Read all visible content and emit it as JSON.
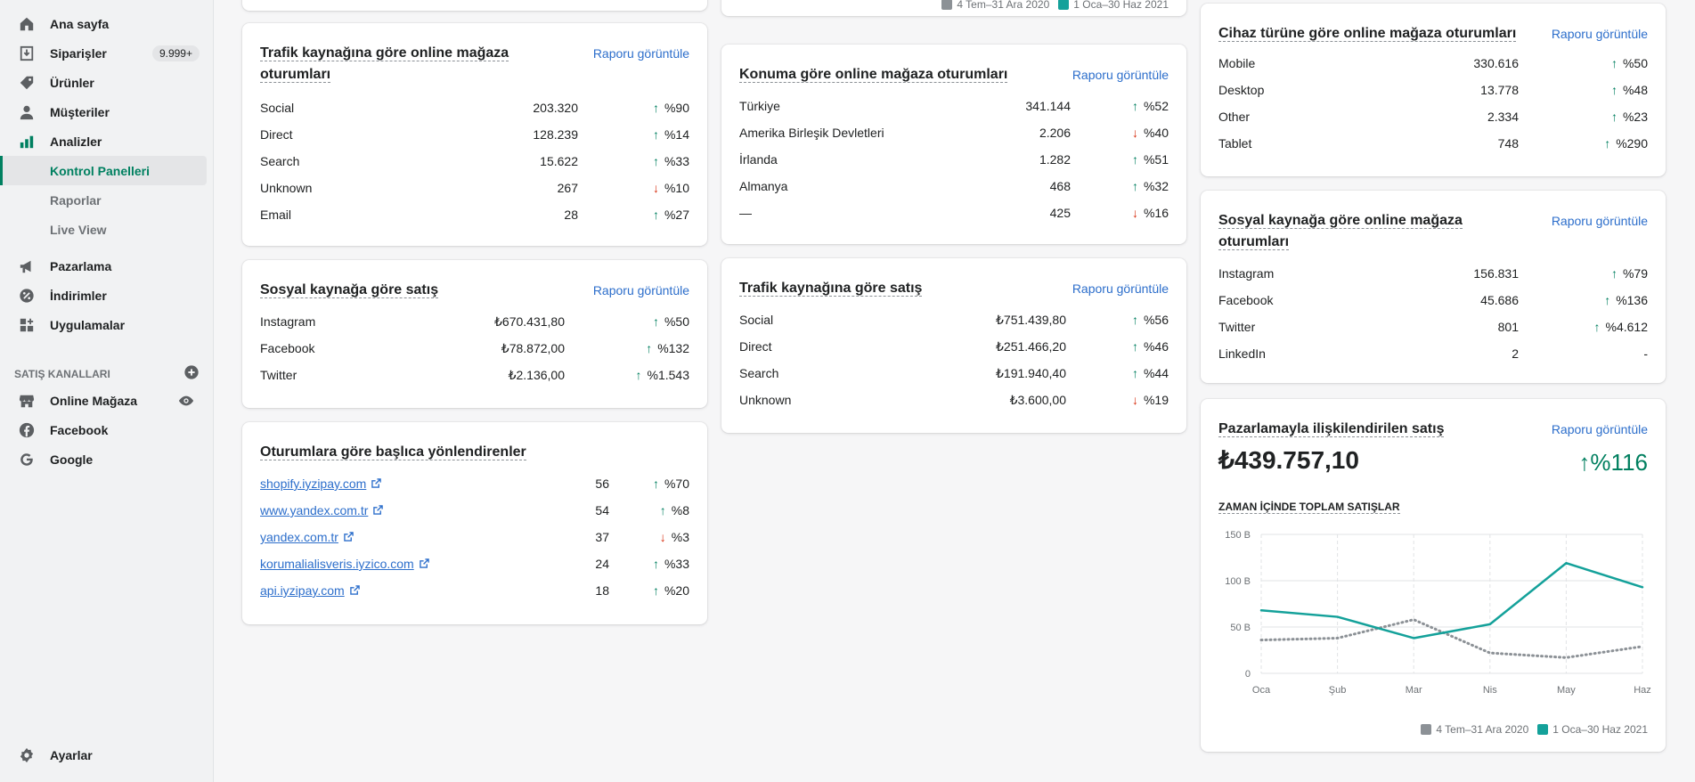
{
  "sidebar": {
    "items": [
      {
        "label": "Ana sayfa",
        "icon": "home-icon"
      },
      {
        "label": "Siparişler",
        "icon": "orders-icon",
        "badge": "9.999+"
      },
      {
        "label": "Ürünler",
        "icon": "tag-icon"
      },
      {
        "label": "Müşteriler",
        "icon": "person-icon"
      },
      {
        "label": "Analizler",
        "icon": "bar-chart-icon"
      }
    ],
    "sub_items": [
      {
        "label": "Kontrol Panelleri",
        "active": true
      },
      {
        "label": "Raporlar"
      },
      {
        "label": "Live View"
      }
    ],
    "items2": [
      {
        "label": "Pazarlama",
        "icon": "megaphone-icon"
      },
      {
        "label": "İndirimler",
        "icon": "discount-icon"
      },
      {
        "label": "Uygulamalar",
        "icon": "apps-icon"
      }
    ],
    "channels_heading": "SATIŞ KANALLARI",
    "channels": [
      {
        "label": "Online Mağaza",
        "icon": "store-icon"
      },
      {
        "label": "Facebook",
        "icon": "facebook-icon"
      },
      {
        "label": "Google",
        "icon": "google-icon"
      }
    ],
    "settings": "Ayarlar"
  },
  "report_link": "Raporu görüntüle",
  "top_legend": {
    "a": "4 Tem–31 Ara 2020",
    "b": "1 Oca–30 Haz 2021"
  },
  "cards": {
    "traffic_sessions": {
      "title": "Trafik kaynağına göre online mağaza oturumları",
      "rows": [
        {
          "name": "Social",
          "value": "203.320",
          "dir": "up",
          "change": "%90"
        },
        {
          "name": "Direct",
          "value": "128.239",
          "dir": "up",
          "change": "%14"
        },
        {
          "name": "Search",
          "value": "15.622",
          "dir": "up",
          "change": "%33"
        },
        {
          "name": "Unknown",
          "value": "267",
          "dir": "down",
          "change": "%10"
        },
        {
          "name": "Email",
          "value": "28",
          "dir": "up",
          "change": "%27"
        }
      ]
    },
    "social_sales": {
      "title": "Sosyal kaynağa göre satış",
      "rows": [
        {
          "name": "Instagram",
          "value": "₺670.431,80",
          "dir": "up",
          "change": "%50"
        },
        {
          "name": "Facebook",
          "value": "₺78.872,00",
          "dir": "up",
          "change": "%132"
        },
        {
          "name": "Twitter",
          "value": "₺2.136,00",
          "dir": "up",
          "change": "%1.543"
        }
      ]
    },
    "referrers": {
      "title": "Oturumlara göre başlıca yönlendirenler",
      "rows": [
        {
          "name": "shopify.iyzipay.com",
          "value": "56",
          "dir": "up",
          "change": "%70"
        },
        {
          "name": "www.yandex.com.tr",
          "value": "54",
          "dir": "up",
          "change": "%8"
        },
        {
          "name": "yandex.com.tr",
          "value": "37",
          "dir": "down",
          "change": "%3"
        },
        {
          "name": "korumalialisveris.iyzico.com",
          "value": "24",
          "dir": "up",
          "change": "%33"
        },
        {
          "name": "api.iyzipay.com",
          "value": "18",
          "dir": "up",
          "change": "%20"
        }
      ]
    },
    "location_sessions": {
      "title": "Konuma göre online mağaza oturumları",
      "rows": [
        {
          "name": "Türkiye",
          "value": "341.144",
          "dir": "up",
          "change": "%52"
        },
        {
          "name": "Amerika Birleşik Devletleri",
          "value": "2.206",
          "dir": "down",
          "change": "%40"
        },
        {
          "name": "İrlanda",
          "value": "1.282",
          "dir": "up",
          "change": "%51"
        },
        {
          "name": "Almanya",
          "value": "468",
          "dir": "up",
          "change": "%32"
        },
        {
          "name": "—",
          "value": "425",
          "dir": "down",
          "change": "%16"
        }
      ]
    },
    "traffic_sales": {
      "title": "Trafik kaynağına göre satış",
      "rows": [
        {
          "name": "Social",
          "value": "₺751.439,80",
          "dir": "up",
          "change": "%56"
        },
        {
          "name": "Direct",
          "value": "₺251.466,20",
          "dir": "up",
          "change": "%46"
        },
        {
          "name": "Search",
          "value": "₺191.940,40",
          "dir": "up",
          "change": "%44"
        },
        {
          "name": "Unknown",
          "value": "₺3.600,00",
          "dir": "down",
          "change": "%19"
        }
      ]
    },
    "device_sessions": {
      "title": "Cihaz türüne göre online mağaza oturumları",
      "rows": [
        {
          "name": "Mobile",
          "value": "330.616",
          "dir": "up",
          "change": "%50"
        },
        {
          "name": "Desktop",
          "value": "13.778",
          "dir": "up",
          "change": "%48"
        },
        {
          "name": "Other",
          "value": "2.334",
          "dir": "up",
          "change": "%23"
        },
        {
          "name": "Tablet",
          "value": "748",
          "dir": "up",
          "change": "%290"
        }
      ]
    },
    "social_sessions": {
      "title": "Sosyal kaynağa göre online mağaza oturumları",
      "rows": [
        {
          "name": "Instagram",
          "value": "156.831",
          "dir": "up",
          "change": "%79"
        },
        {
          "name": "Facebook",
          "value": "45.686",
          "dir": "up",
          "change": "%136"
        },
        {
          "name": "Twitter",
          "value": "801",
          "dir": "up",
          "change": "%4.612"
        },
        {
          "name": "LinkedIn",
          "value": "2",
          "dir": "none",
          "change": "-"
        }
      ]
    },
    "marketing": {
      "title": "Pazarlamayla ilişkilendirilen satış",
      "total": "₺439.757,10",
      "change": "%116",
      "subtitle": "ZAMAN İÇİNDE TOPLAM SATIŞLAR"
    }
  },
  "chart_data": {
    "type": "line",
    "x": [
      "Oca",
      "Şub",
      "Mar",
      "Nis",
      "May",
      "Haz"
    ],
    "y_ticks": [
      "0",
      "50 B",
      "100 B",
      "150 B"
    ],
    "ylim": [
      0,
      150
    ],
    "series": [
      {
        "name": "4 Tem–31 Ara 2020",
        "values": [
          36,
          38,
          58,
          22,
          17,
          29
        ],
        "color": "#8c9196",
        "style": "dotted"
      },
      {
        "name": "1 Oca–30 Haz 2021",
        "values": [
          68,
          61,
          38,
          53,
          119,
          93
        ],
        "color": "#14a19a",
        "style": "solid"
      }
    ]
  },
  "colors": {
    "accent": "#008060",
    "link": "#2c6ecb",
    "up": "#007f5f",
    "down": "#d72c0d"
  }
}
